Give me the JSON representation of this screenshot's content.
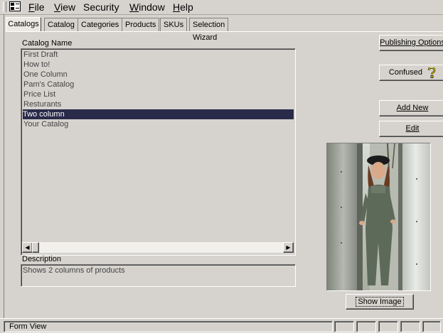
{
  "menu": {
    "items": [
      {
        "label": "File",
        "u": "F",
        "rest": "ile"
      },
      {
        "label": "View",
        "u": "V",
        "rest": "iew"
      },
      {
        "label": "Security",
        "u": "",
        "rest": "Security"
      },
      {
        "label": "Window",
        "u": "W",
        "rest": "indow"
      },
      {
        "label": "Help",
        "u": "H",
        "rest": "elp"
      }
    ]
  },
  "tabs": [
    {
      "label": "Catalogs",
      "active": true
    },
    {
      "label": "Catalog"
    },
    {
      "label": "Categories"
    },
    {
      "label": "Products"
    },
    {
      "label": "SKUs"
    },
    {
      "label": "Selection Wizard"
    }
  ],
  "catalog_list": {
    "header": "Catalog Name",
    "items": [
      "First Draft",
      "How to!",
      "One Column",
      "Pam's Catalog",
      "Price List",
      "Resturants",
      "Two column",
      "Your Catalog"
    ],
    "selected": "Two column"
  },
  "description": {
    "label": "Description",
    "value": "Shows 2 columns of products"
  },
  "buttons": {
    "publishing_options": "Publishing Options",
    "confused": "Confused",
    "add_new": "Add New",
    "edit": "Edit",
    "show_image": "Show Image"
  },
  "statusbar": {
    "text": "Form View"
  }
}
